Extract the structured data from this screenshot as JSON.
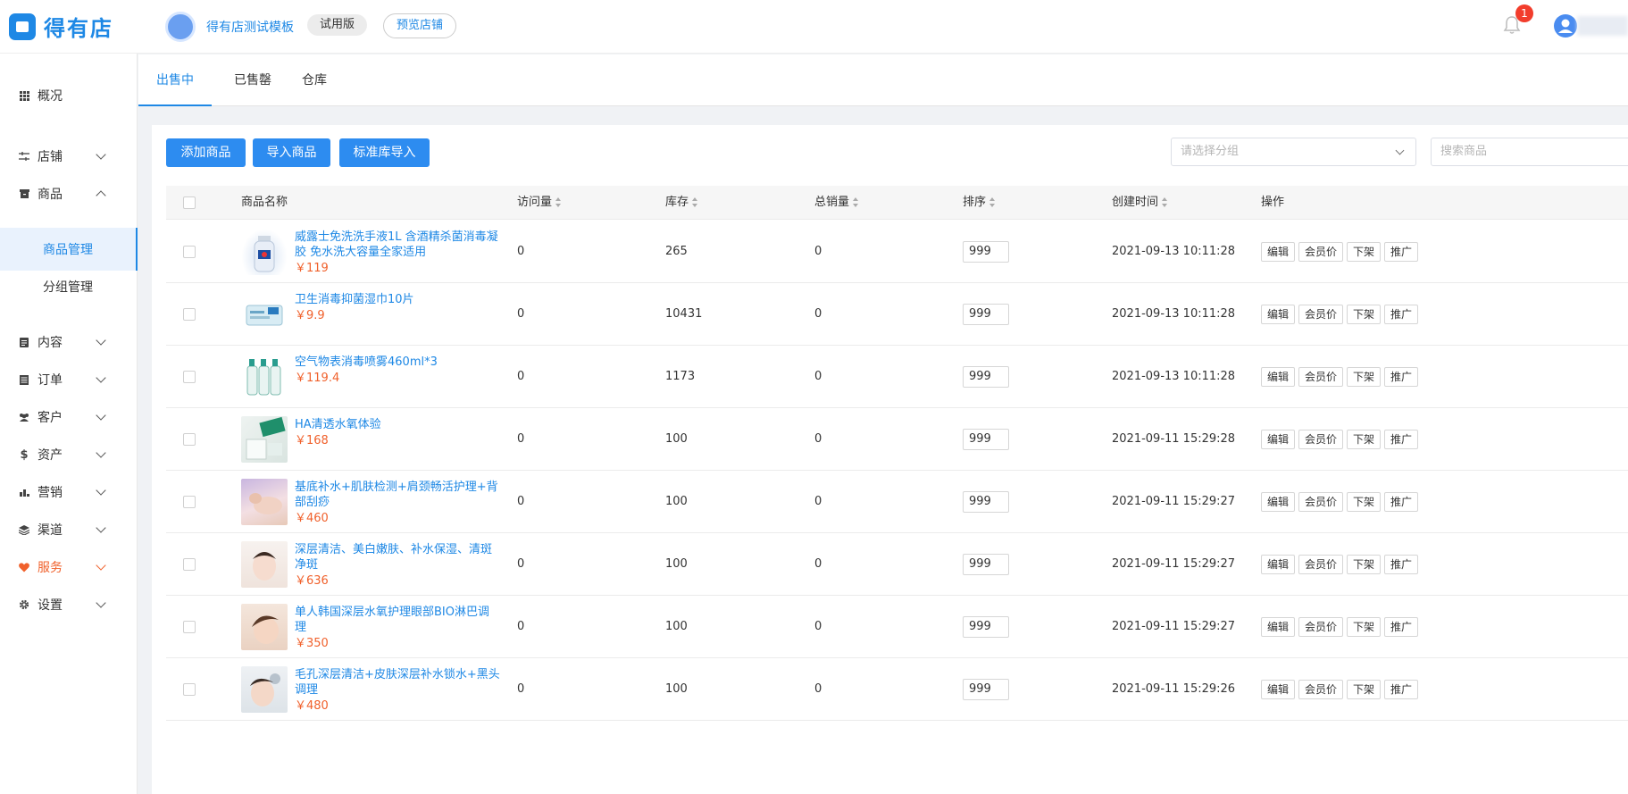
{
  "header": {
    "logo_text": "得有店",
    "store_name": "得有店测试模板",
    "trial_badge": "试用版",
    "preview_button": "预览店铺",
    "notification_count": "1"
  },
  "sidebar": {
    "items": [
      {
        "label": "概况",
        "icon": "grid-icon"
      },
      {
        "label": "店铺",
        "icon": "sliders-icon"
      },
      {
        "label": "商品",
        "icon": "box-icon"
      },
      {
        "label": "内容",
        "icon": "document-icon"
      },
      {
        "label": "订单",
        "icon": "list-icon"
      },
      {
        "label": "客户",
        "icon": "users-icon"
      },
      {
        "label": "资产",
        "icon": "dollar-icon"
      },
      {
        "label": "营销",
        "icon": "bar-chart-icon"
      },
      {
        "label": "渠道",
        "icon": "layers-icon"
      },
      {
        "label": "服务",
        "icon": "heart-icon"
      },
      {
        "label": "设置",
        "icon": "gear-icon"
      }
    ],
    "sub_items": [
      {
        "label": "商品管理",
        "active": true
      },
      {
        "label": "分组管理",
        "active": false
      }
    ],
    "service_color": "#f0612c"
  },
  "tabs": [
    {
      "label": "出售中",
      "active": true
    },
    {
      "label": "已售罄",
      "active": false
    },
    {
      "label": "仓库",
      "active": false
    }
  ],
  "toolbar": {
    "add_product": "添加商品",
    "import_product": "导入商品",
    "standard_import": "标准库导入",
    "group_select_placeholder": "请选择分组",
    "search_placeholder": "搜索商品"
  },
  "table": {
    "columns": {
      "name": "商品名称",
      "visits": "访问量",
      "stock": "库存",
      "sales": "总销量",
      "sort": "排序",
      "created": "创建时间",
      "actions": "操作"
    },
    "action_labels": {
      "edit": "编辑",
      "member_price": "会员价",
      "unlist": "下架",
      "promote": "推广"
    },
    "rows": [
      {
        "name": "威露士免洗洗手液1L 含酒精杀菌消毒凝胶 免水洗大容量全家适用",
        "price": "￥119",
        "visits": "0",
        "stock": "265",
        "sales": "0",
        "sort": "999",
        "created": "2021-09-13 10:11:28"
      },
      {
        "name": "卫生消毒抑菌湿巾10片",
        "price": "￥9.9",
        "visits": "0",
        "stock": "10431",
        "sales": "0",
        "sort": "999",
        "created": "2021-09-13 10:11:28"
      },
      {
        "name": "空气物表消毒喷雾460ml*3",
        "price": "￥119.4",
        "visits": "0",
        "stock": "1173",
        "sales": "0",
        "sort": "999",
        "created": "2021-09-13 10:11:28"
      },
      {
        "name": "HA清透水氧体验",
        "price": "￥168",
        "visits": "0",
        "stock": "100",
        "sales": "0",
        "sort": "999",
        "created": "2021-09-11 15:29:28"
      },
      {
        "name": "基底补水+肌肤检测+肩颈畅活护理+背部刮痧",
        "price": "￥460",
        "visits": "0",
        "stock": "100",
        "sales": "0",
        "sort": "999",
        "created": "2021-09-11 15:29:27"
      },
      {
        "name": "深层清洁、美白嫩肤、补水保湿、清斑净斑",
        "price": "￥636",
        "visits": "0",
        "stock": "100",
        "sales": "0",
        "sort": "999",
        "created": "2021-09-11 15:29:27"
      },
      {
        "name": "单人韩国深层水氧护理眼部BIO淋巴调理",
        "price": "￥350",
        "visits": "0",
        "stock": "100",
        "sales": "0",
        "sort": "999",
        "created": "2021-09-11 15:29:27"
      },
      {
        "name": "毛孔深层清洁+皮肤深层补水锁水+黑头调理",
        "price": "￥480",
        "visits": "0",
        "stock": "100",
        "sales": "0",
        "sort": "999",
        "created": "2021-09-11 15:29:26"
      }
    ]
  },
  "colors": {
    "accent": "#1e88e5",
    "button": "#2d8cf0",
    "price": "#f0612c",
    "badge": "#f23d2c"
  }
}
